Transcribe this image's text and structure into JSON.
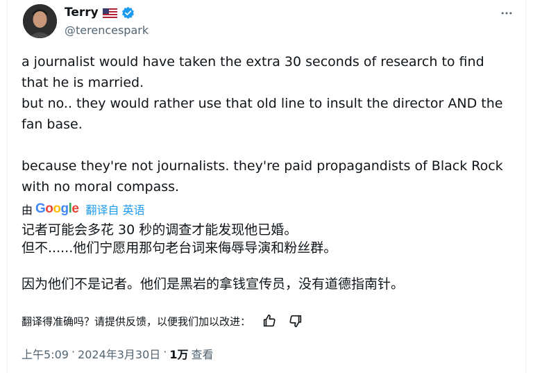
{
  "author": {
    "display_name": "Terry",
    "handle": "@terencespark",
    "flag_icon": "us-flag-icon",
    "verified_icon": "verified-badge-icon"
  },
  "tweet": {
    "text": "a journalist would have taken the extra 30 seconds of research to find\nthat he is married.\nbut no.. they would rather use that old line to insult the director AND the\nfan base.\n\nbecause they're not journalists. they're paid propagandists of Black Rock\nwith no moral compass."
  },
  "translation": {
    "by_label": "由",
    "google_letters": [
      "G",
      "o",
      "o",
      "g",
      "l",
      "e"
    ],
    "from_label": "翻译自 英语",
    "text": "记者可能会多花 30 秒的调查才能发现他已婚。\n但不......他们宁愿用那句老台词来侮辱导演和粉丝群。\n\n因为他们不是记者。他们是黑岩的拿钱宣传员，没有道德指南针。",
    "feedback_prompt": "翻译得准确吗？请提供反馈，以便我们加以改进："
  },
  "meta": {
    "time": "上午5:09",
    "sep1": "·",
    "date": "2024年3月30日",
    "sep2": "·",
    "views": "1万",
    "views_label": "查看"
  },
  "colors": {
    "link": "#1d9bf0",
    "secondary": "#536471",
    "text": "#0f1419"
  }
}
